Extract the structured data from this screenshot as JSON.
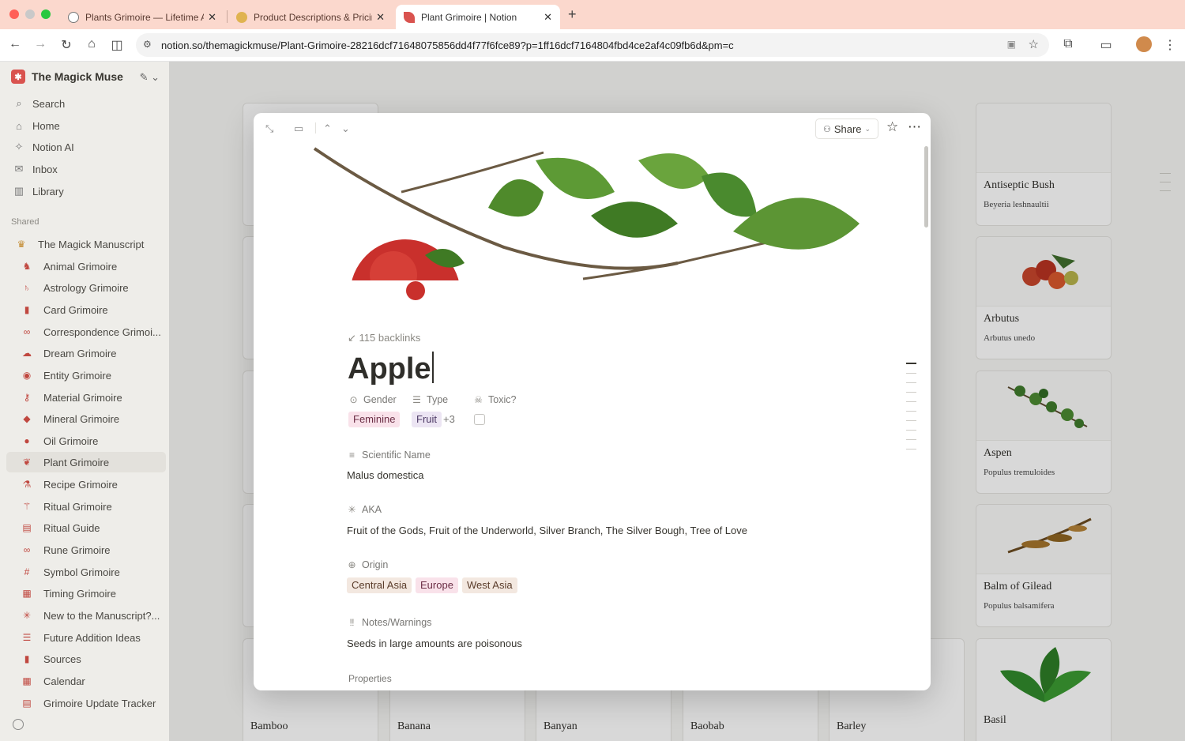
{
  "browser": {
    "tabs": [
      {
        "title": "Plants Grimoire — Lifetime Ac",
        "close": "✕"
      },
      {
        "title": "Product Descriptions & Pricin",
        "close": "✕"
      },
      {
        "title": "Plant Grimoire | Notion",
        "close": "✕"
      }
    ],
    "new_tab": "+",
    "url": "notion.so/themagickmuse/Plant-Grimoire-28216dcf71648075856dd4f77f6fce89?p=1ff16dcf7164804fbd4ce2af4c09fb6d&pm=c"
  },
  "sidebar": {
    "workspace": "The Magick Muse",
    "nav": [
      {
        "label": "Search",
        "icon": "search-icon"
      },
      {
        "label": "Home",
        "icon": "home-icon"
      },
      {
        "label": "Notion AI",
        "icon": "ai-icon"
      },
      {
        "label": "Inbox",
        "icon": "inbox-icon"
      },
      {
        "label": "Library",
        "icon": "library-icon"
      }
    ],
    "section": "Shared",
    "items": [
      {
        "label": "The Magick Manuscript"
      },
      {
        "label": "Animal Grimoire"
      },
      {
        "label": "Astrology Grimoire"
      },
      {
        "label": "Card Grimoire"
      },
      {
        "label": "Correspondence Grimoi..."
      },
      {
        "label": "Dream Grimoire"
      },
      {
        "label": "Entity Grimoire"
      },
      {
        "label": "Material Grimoire"
      },
      {
        "label": "Mineral Grimoire"
      },
      {
        "label": "Oil Grimoire"
      },
      {
        "label": "Plant Grimoire"
      },
      {
        "label": "Recipe Grimoire"
      },
      {
        "label": "Ritual Grimoire"
      },
      {
        "label": "Ritual Guide"
      },
      {
        "label": "Rune Grimoire"
      },
      {
        "label": "Symbol Grimoire"
      },
      {
        "label": "Timing Grimoire"
      },
      {
        "label": "New to the Manuscript?..."
      },
      {
        "label": "Future Addition Ideas"
      },
      {
        "label": "Sources"
      },
      {
        "label": "Calendar"
      },
      {
        "label": "Grimoire Update Tracker"
      }
    ]
  },
  "gallery": {
    "right_column": [
      {
        "name": "Antiseptic Bush",
        "sci": "Beyeria leshnaultii"
      },
      {
        "name": "Arbutus",
        "sci": "Arbutus unedo"
      },
      {
        "name": "Aspen",
        "sci": "Populus tremuloides"
      },
      {
        "name": "Balm of Gilead",
        "sci": "Populus balsamifera"
      }
    ],
    "bottom_row": [
      "Bamboo",
      "Banana",
      "Banyan",
      "Baobab",
      "Barley",
      "Basil"
    ]
  },
  "page": {
    "share_label": "Share",
    "backlinks": "115 backlinks",
    "title": "Apple",
    "gender_label": "Gender",
    "gender_value": "Feminine",
    "type_label": "Type",
    "type_value": "Fruit",
    "type_more": "+3",
    "toxic_label": "Toxic?",
    "scientific_label": "Scientific Name",
    "scientific_value": "Malus domestica",
    "aka_label": "AKA",
    "aka_value": "Fruit of the Gods, Fruit of the Underworld, Silver Branch, The Silver Bough, Tree of Love",
    "origin_label": "Origin",
    "origin_values": [
      "Central Asia",
      "Europe",
      "West Asia"
    ],
    "notes_label": "Notes/Warnings",
    "notes_value": "Seeds in large amounts are poisonous",
    "properties_heading": "Properties"
  },
  "colors": {
    "tabbar": "#fbd8cd",
    "tag_pink": "#f9e2ea",
    "tag_purple": "#ece5f3",
    "tag_brown": "#f3e8e0"
  }
}
